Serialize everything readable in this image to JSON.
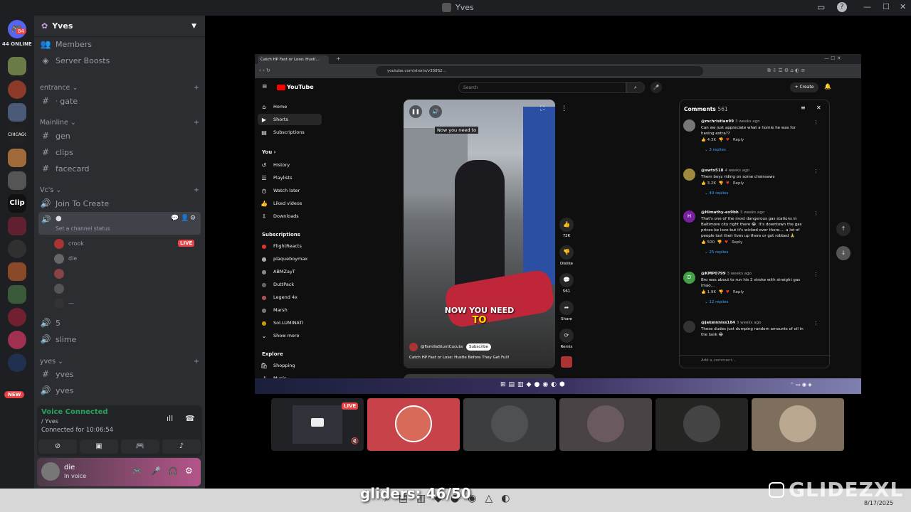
{
  "window": {
    "title": "Yves"
  },
  "servers": {
    "online_count": "44 ONLINE",
    "badge": "84",
    "clip_label": "Clip",
    "new_badge": "NEW"
  },
  "server": {
    "name": "Yves",
    "top_items": [
      {
        "icon": "people-icon",
        "label": "Members"
      },
      {
        "icon": "boost-icon",
        "label": "Server Boosts"
      }
    ],
    "categories": [
      {
        "name": "entrance",
        "channels": [
          {
            "type": "text",
            "name": "ᐧ gate"
          }
        ]
      },
      {
        "name": "Mainline",
        "channels": [
          {
            "type": "text",
            "name": "gen"
          },
          {
            "type": "text",
            "name": "clips"
          },
          {
            "type": "text",
            "name": "facecard"
          }
        ]
      },
      {
        "name": "Vc's",
        "channels": [
          {
            "type": "voice",
            "name": "Join To Create"
          }
        ]
      }
    ],
    "active_voice": {
      "status": "Set a channel status",
      "members": [
        "crook",
        "die",
        "",
        "",
        "—"
      ],
      "live_label": "LIVE"
    },
    "more_voice": [
      "5",
      "slime"
    ],
    "yves_category": "yves",
    "yves_channels": [
      {
        "type": "text",
        "name": "yves"
      },
      {
        "type": "voice",
        "name": "yves"
      }
    ]
  },
  "voice_panel": {
    "status": "Voice Connected",
    "channel": "/ Yves",
    "connected_for": "Connected for 10:06:54"
  },
  "user_panel": {
    "name": "die",
    "status": "In voice"
  },
  "browser": {
    "tab_title": "Catch HP Fast or Lose: Hustl…",
    "url": "youtube.com/shorts/v3S8S2…",
    "logo": "YouTube",
    "search_placeholder": "Search",
    "create_label": "Create",
    "nav": [
      "Home",
      "Shorts",
      "Subscriptions"
    ],
    "you_heading": "You",
    "you_items": [
      "History",
      "Playlists",
      "Watch later",
      "Liked videos",
      "Downloads"
    ],
    "subs_heading": "Subscriptions",
    "subs": [
      "FlightReacts",
      "plaqueboymax",
      "ABMZayT",
      "DuttPack",
      "Legend 4x",
      "Marsh",
      "Sol.LUMINATI"
    ],
    "show_more": "Show more",
    "explore_heading": "Explore",
    "explore": [
      "Shopping",
      "Music"
    ]
  },
  "short": {
    "top_caption": "Now you need to",
    "big_caption_1": "NOW YOU NEED",
    "big_caption_2": "TO",
    "channel": "@FamiliaStuntCucuta",
    "subscribe": "Subscribe",
    "title": "Catch HP Fast or Lose: Hustle Before They Get Full!",
    "likes": "72K",
    "dislike": "Dislike",
    "comments": "561",
    "share": "Share",
    "remix": "Remix"
  },
  "comments": {
    "title": "Comments",
    "count": "561",
    "add_placeholder": "Add a comment...",
    "reply_label": "Reply",
    "items": [
      {
        "initial": "",
        "author": "@mchristian99",
        "age": "3 weeks ago",
        "text": "Can we just appreciate what a homie he was for having extra??",
        "likes": "4.3K",
        "replies": "3 replies",
        "color": "#777777"
      },
      {
        "initial": "",
        "author": "@swtx518",
        "age": "4 weeks ago",
        "text": "Them boyz riding on some chainsaws",
        "likes": "3.2K",
        "replies": "40 replies",
        "color": "#a08a40"
      },
      {
        "initial": "H",
        "author": "@Himathy-ex9bh",
        "age": "3 weeks ago",
        "text": "That's one of the most dangerous gas stations in Baltimore city right there 😂. It's downtown the gas prices be love but it's wicked over there…. a lot of people lost their lives up there or got robbed 🙏",
        "likes": "500",
        "replies": "25 replies",
        "color": "#7b1fa2"
      },
      {
        "initial": "D",
        "author": "@KMP0799",
        "age": "3 weeks ago",
        "text": "Bro was about to run his 2 stroke with straight gas lmao…",
        "likes": "1.9K",
        "replies": "12 replies",
        "color": "#43a047"
      },
      {
        "initial": "",
        "author": "@jakeinniss184",
        "age": "3 weeks ago",
        "text": "These dudes just dumping random amounts of oil in the tank 😂",
        "likes": "",
        "replies": "",
        "color": "#333333"
      }
    ]
  },
  "stream_tiles": {
    "live_label": "LIVE"
  },
  "overlay": {
    "gliders": "gliders: 46/50",
    "brand": "GLIDEZXL",
    "date": "8/17/2025"
  },
  "colors": {
    "discord_green": "#23a55a",
    "live_red": "#ed4245",
    "yt_red": "#ff0000",
    "blurple": "#5865f2"
  }
}
